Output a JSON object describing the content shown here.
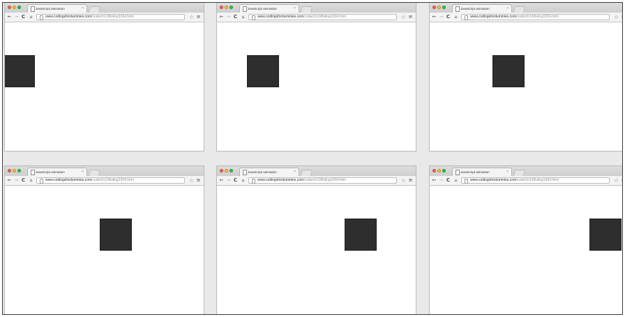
{
  "colors": {
    "close": "#ff5f57",
    "minimize": "#ffbd2e",
    "zoom": "#28c940",
    "box": "#2e2e2e"
  },
  "browser": {
    "tab_title": "JavaScript animation",
    "tab_close": "×",
    "url_host": "www.codingsfordummies.com",
    "url_path": "/code/ch13/listing1304.html",
    "icons": {
      "back": "←",
      "forward": "→",
      "reload": "C",
      "home": "⌂",
      "star": "☆",
      "menu": "≡"
    }
  },
  "frames": [
    {
      "box_position": 0.0
    },
    {
      "box_position": 0.2
    },
    {
      "box_position": 0.4
    },
    {
      "box_position": 0.6
    },
    {
      "box_position": 0.8
    },
    {
      "box_position": 1.0
    }
  ]
}
